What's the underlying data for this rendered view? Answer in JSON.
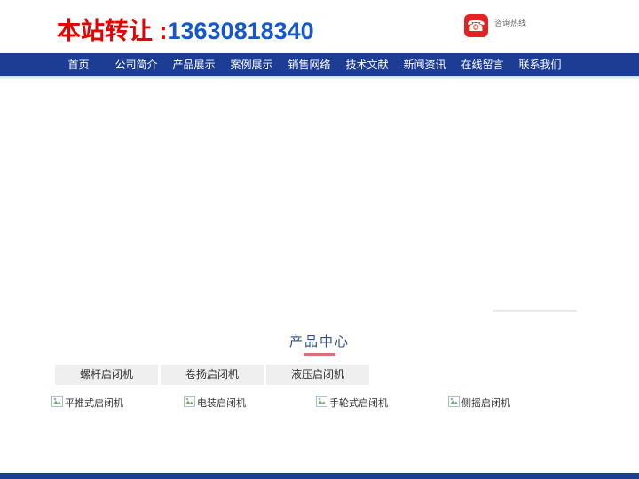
{
  "header": {
    "transfer_label": "本站转让 :",
    "transfer_phone": "13630818340",
    "hotline_label": "咨询热线"
  },
  "nav": {
    "items": [
      {
        "label": "首页"
      },
      {
        "label": "公司简介"
      },
      {
        "label": "产品展示"
      },
      {
        "label": "案例展示"
      },
      {
        "label": "销售网络"
      },
      {
        "label": "技术文献"
      },
      {
        "label": "新闻资讯"
      },
      {
        "label": "在线留言"
      },
      {
        "label": "联系我们"
      }
    ]
  },
  "products": {
    "section_title": "产品中心",
    "tabs": [
      {
        "label": "螺杆启闭机"
      },
      {
        "label": "卷扬启闭机"
      },
      {
        "label": "液压启闭机"
      }
    ],
    "items": [
      {
        "label": "平推式启闭机"
      },
      {
        "label": "电装启闭机"
      },
      {
        "label": "手轮式启闭机"
      },
      {
        "label": "侧摇启闭机"
      }
    ]
  },
  "icons": {
    "phone": "telephone-icon",
    "broken_image": "broken-image-icon"
  },
  "colors": {
    "accent_red": "#e60000",
    "phone_blue": "#1557d0",
    "nav_blue": "#1d3d94",
    "title_navy": "#2e4e8e",
    "underline_red": "#e0716d",
    "tab_bg": "#f0efef"
  }
}
